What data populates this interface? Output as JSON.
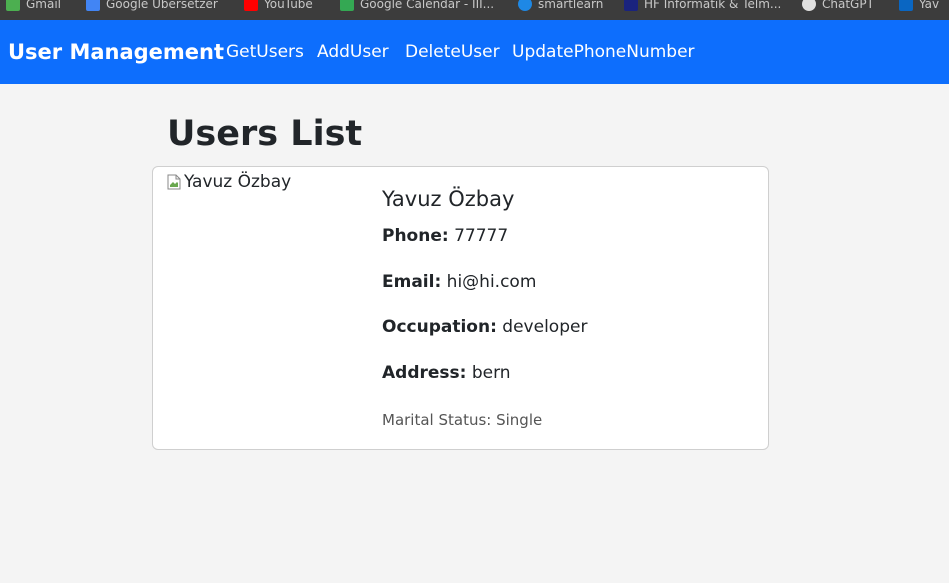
{
  "bookmarks": [
    {
      "label": "Gmail",
      "icon": "gmail-icon",
      "color": "#4caf50"
    },
    {
      "label": "Google Übersetzer",
      "icon": "translate-icon",
      "color": "#4285f4"
    },
    {
      "label": "YouTube",
      "icon": "youtube-icon",
      "color": "#ff0000"
    },
    {
      "label": "Google Calendar - III...",
      "icon": "calendar-icon",
      "color": "#34a853"
    },
    {
      "label": "smartlearn",
      "icon": "shield-icon",
      "color": "#1e88e5"
    },
    {
      "label": "HF Informatik & Telm...",
      "icon": "school-icon",
      "color": "#1a237e"
    },
    {
      "label": "ChatGPT",
      "icon": "chatgpt-icon",
      "color": "#e0e0e0"
    },
    {
      "label": "Yav",
      "icon": "linkedin-icon",
      "color": "#0a66c2"
    }
  ],
  "navbar": {
    "brand": "User Management",
    "links": [
      "GetUsers",
      "AddUser",
      "DeleteUser",
      "UpdatePhoneNumber"
    ],
    "bg_color": "#0d6efd"
  },
  "main": {
    "title": "Users List"
  },
  "user": {
    "image_alt": "Yavuz Özbay",
    "name": "Yavuz Özbay",
    "phone_label": "Phone:",
    "phone": "77777",
    "email_label": "Email:",
    "email": "hi@hi.com",
    "occupation_label": "Occupation:",
    "occupation": "developer",
    "address_label": "Address:",
    "address": "bern",
    "marital_status": "Marital Status: Single"
  }
}
